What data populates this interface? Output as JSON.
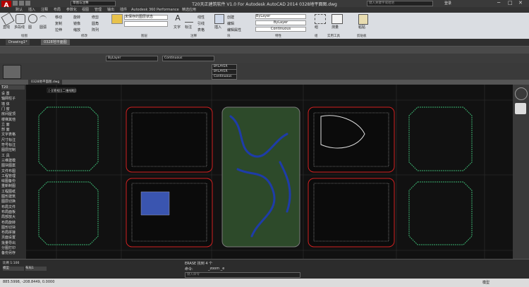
{
  "title": "T20天正建筑软件 V1.0 For Autodesk AutoCAD 2014    0328地平面图.dwg",
  "quick_access": {
    "workspace": "草图与注释"
  },
  "search": {
    "placeholder": "键入关键字或短语"
  },
  "login": "登录",
  "menu_tabs": [
    "默认",
    "插入",
    "注释",
    "布局",
    "参数化",
    "视图",
    "管理",
    "输出",
    "插件",
    "Autodesk 360",
    "Performance",
    "精选应用"
  ],
  "ribbon": {
    "draw_tools": [
      "直线",
      "多段线",
      "圆",
      "圆弧"
    ],
    "modify_tools": [
      "移动",
      "旋转",
      "修剪",
      "复制",
      "镜像",
      "圆角",
      "拉伸",
      "缩放",
      "阵列"
    ],
    "annotation": [
      "文字",
      "标注"
    ],
    "annotation_small": [
      "线性",
      "引线",
      "表格"
    ],
    "layer_state": "未保存的图层状态",
    "insert": "插入",
    "block_tools": [
      "创建",
      "编辑",
      "编辑属性"
    ],
    "property_color": "ByLayer",
    "property_lineweight": "ByLayer",
    "property_linetype": "Continuous",
    "group": "组",
    "utilities": "实用工具",
    "clipboard": "剪贴板",
    "measure": "测量",
    "paste": "粘贴",
    "panel_labels": [
      "绘图",
      "修改",
      "图层",
      "注释",
      "块",
      "特性",
      "组",
      "实用工具",
      "剪贴板"
    ]
  },
  "file_tabs": [
    "Drawing1*",
    "0328地平面图"
  ],
  "toolbar3": {
    "layer_dropdown": "ByLayer",
    "linetype": "Continuous",
    "bylayer_items": [
      "BYLAYER",
      "BYLAYER",
      "Continuous"
    ]
  },
  "doc_tab": "0328地平面图.dwg",
  "palette_title": "T20",
  "palette_items": [
    "设  置",
    "轴网柱子",
    "墙  体",
    "门  窗",
    "房间屋顶",
    "楼梯其他",
    "立  面",
    "剖  面",
    "文字表格",
    "尺寸标注",
    "符号标注",
    "图层控制",
    "工  具",
    "三维建模",
    "图块图案",
    "文件布图",
    "工程管理",
    "绘图备份",
    "重新制图",
    "工程图纸",
    "图形建筑",
    "图层切换",
    "布局文件",
    "布局面板",
    "局部放大",
    "布局旋转",
    "图形切块",
    "布局拼接",
    "页面设置",
    "批量导出",
    "分图打印",
    "备份另存"
  ],
  "canvas_label": "[-][俯视][二维线框]",
  "command_history": [
    "ERASE 找到 4 个",
    "命令:"
  ],
  "command_prompt": "_zoom _e",
  "command_input_placeholder": "键入命令",
  "scale": "比例 1:100",
  "layout_tabs": [
    "模型",
    "布局1"
  ],
  "coordinates": "885.5998, -208.8449, 0.0000",
  "status_mode": "模型",
  "colors": {
    "accent": "#b30000",
    "ribbon": "#dadde2",
    "canvas": "#111111",
    "green_line": "#3cb371",
    "red_line": "#d02020",
    "blue_line": "#1e3ca8"
  }
}
